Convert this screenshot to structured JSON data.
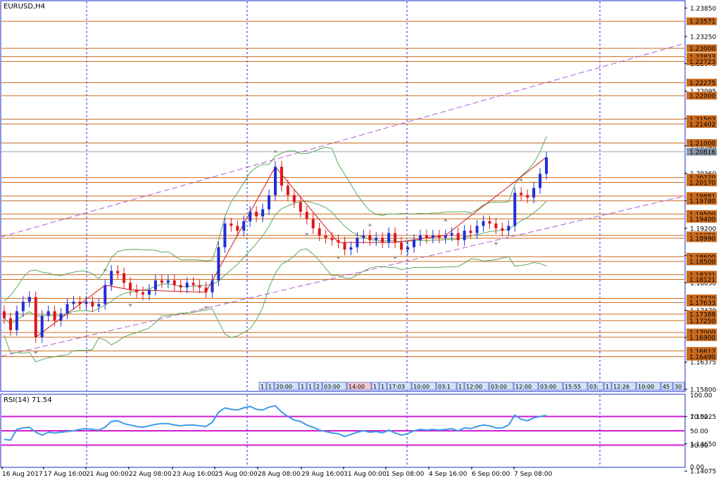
{
  "window": {
    "symbol_title": "EURUSD,H4",
    "rsi_title": "RSI(14) 71.54"
  },
  "colors": {
    "bull": "#1f2fd8",
    "bear": "#e0161d",
    "level": "#c96a1e",
    "tag": "#c96a1e",
    "current_tag": "#8a96a8",
    "channel": "#b25ad2",
    "band": "#5aa85a",
    "rsi_line": "#3c9be8",
    "rsi_level": "#d21ad2",
    "vgrid": "#2a32d0",
    "frame": "#1e2cc8"
  },
  "chart_data": {
    "type": "candlestick",
    "price_ylim": [
      1.1577,
      1.2399
    ],
    "price_ticks": [
      "1.23850",
      "1.23250",
      "1.22675",
      "1.22095",
      "1.21515",
      "1.20940",
      "1.20360",
      "1.19780",
      "1.19200",
      "1.18625",
      "1.18050",
      "1.17470",
      "1.16895",
      "1.16375",
      "1.15800",
      "1.15225",
      "1.14650",
      "1.14075"
    ],
    "levels": [
      1.23571,
      1.23,
      1.22823,
      1.22723,
      1.22275,
      1.22,
      1.21502,
      1.21402,
      1.21,
      1.2027,
      1.2017,
      1.19881,
      1.1978,
      1.195,
      1.194,
      1.1905,
      1.1899,
      1.186,
      1.185,
      1.18221,
      1.18121,
      1.1772,
      1.17633,
      1.17388,
      1.1725,
      1.17,
      1.169,
      1.16612,
      1.1649
    ],
    "level_tags": [
      "1.23571",
      "1.23000",
      "1.22823",
      "1.22723",
      "1.22275",
      "1.22000",
      "1.21502",
      "1.21402",
      "1.21000",
      "1.20270",
      "1.20170",
      "1.19881",
      "1.19780",
      "1.19500",
      "1.19400",
      "1.19050",
      "1.18990",
      "1.18600",
      "1.18500",
      "1.18221",
      "1.18121",
      "1.17720",
      "1.17633",
      "1.17388",
      "1.17250",
      "1.17000",
      "1.16900",
      "1.16612",
      "1.16490"
    ],
    "current_price": "1.20816",
    "x_labels": [
      "16 Aug 2017",
      "17 Aug 16:00",
      "21 Aug 00:00",
      "22 Aug 08:00",
      "23 Aug 16:00",
      "25 Aug 00:00",
      "28 Aug 08:00",
      "29 Aug 16:00",
      "31 Aug 00:00",
      "1 Sep 08:00",
      "4 Sep 16:00",
      "6 Sep 00:00",
      "7 Sep 08:00"
    ],
    "closes": [
      1.173,
      1.1705,
      1.1745,
      1.1765,
      1.1775,
      1.169,
      1.1735,
      1.1745,
      1.1725,
      1.174,
      1.176,
      1.1765,
      1.176,
      1.1765,
      1.1755,
      1.176,
      1.18,
      1.183,
      1.1825,
      1.1805,
      1.179,
      1.1785,
      1.178,
      1.179,
      1.181,
      1.1805,
      1.181,
      1.18,
      1.1795,
      1.1805,
      1.18,
      1.1795,
      1.1785,
      1.181,
      1.188,
      1.193,
      1.1925,
      1.1915,
      1.1935,
      1.1955,
      1.1945,
      1.196,
      1.199,
      1.205,
      1.201,
      1.199,
      1.1975,
      1.1955,
      1.194,
      1.192,
      1.1905,
      1.19,
      1.1895,
      1.189,
      1.1875,
      1.188,
      1.19,
      1.1905,
      1.1895,
      1.19,
      1.189,
      1.191,
      1.189,
      1.1875,
      1.188,
      1.1895,
      1.1905,
      1.19,
      1.1905,
      1.19,
      1.1905,
      1.191,
      1.1895,
      1.1915,
      1.191,
      1.1925,
      1.1935,
      1.193,
      1.192,
      1.1915,
      1.1925,
      1.1995,
      1.199,
      1.1985,
      1.2005,
      1.2035,
      1.207
    ],
    "rsi": {
      "ylim": [
        0,
        100
      ],
      "ticks": [
        "100.00",
        "70.00",
        "50.00",
        "30.00",
        "0.00"
      ],
      "levels": [
        70,
        50,
        30
      ],
      "values": [
        38,
        37,
        52,
        54,
        55,
        48,
        44,
        48,
        47,
        48,
        49,
        50,
        52,
        53,
        52,
        51,
        55,
        63,
        64,
        60,
        58,
        56,
        55,
        57,
        59,
        60,
        60,
        58,
        57,
        58,
        58,
        57,
        56,
        62,
        76,
        82,
        80,
        79,
        82,
        84,
        80,
        79,
        83,
        85,
        76,
        70,
        65,
        63,
        58,
        55,
        51,
        49,
        47,
        46,
        42,
        45,
        48,
        50,
        48,
        49,
        47,
        51,
        47,
        44,
        46,
        50,
        52,
        51,
        52,
        51,
        52,
        53,
        50,
        54,
        53,
        56,
        58,
        57,
        54,
        54,
        58,
        72,
        66,
        64,
        68,
        70,
        71.54
      ]
    },
    "trade_tags": [
      "1",
      "1",
      "20:00",
      "1",
      "1",
      "2",
      "03:00",
      "14:00",
      "1",
      "1",
      "17:03",
      "10:00",
      "03:1",
      "1",
      "12:00",
      "03:00",
      "12:00",
      "03:00",
      "15:55",
      "03:",
      "1",
      "12:26",
      "10:00",
      "45",
      "30"
    ]
  }
}
